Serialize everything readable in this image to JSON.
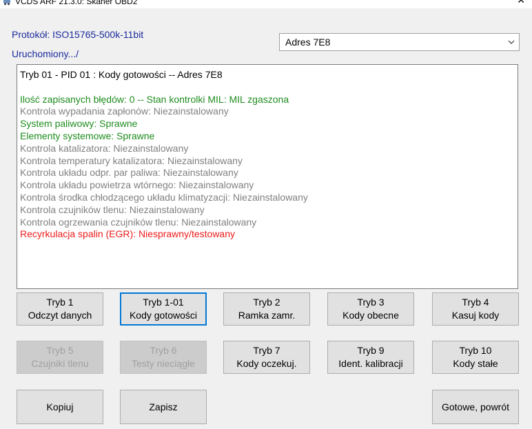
{
  "window": {
    "title": "VCDS ARF 21.3.0: Skaner OBD2",
    "close_glyph": "✕"
  },
  "header": {
    "protocol": "Protokół: ISO15765-500k-11bit",
    "status": "Uruchomiony.../"
  },
  "address_select": {
    "selected": "Adres 7E8"
  },
  "output": {
    "lines": [
      {
        "text": "Tryb 01 - PID 01 : Kody gotowości  --  Adres 7E8",
        "color": "#000000"
      },
      {
        "text": "",
        "color": "#000000"
      },
      {
        "text": "Ilość zapisanych błędów: 0  --  Stan kontrolki MIL: MIL zgaszona",
        "color": "#1e8c1e"
      },
      {
        "text": "Kontrola wypadania zapłonów: Niezainstalowany",
        "color": "#808080"
      },
      {
        "text": "System paliwowy:  Sprawne",
        "color": "#1e8c1e"
      },
      {
        "text": "Elementy systemowe:  Sprawne",
        "color": "#1e8c1e"
      },
      {
        "text": "Kontrola katalizatora: Niezainstalowany",
        "color": "#808080"
      },
      {
        "text": "Kontrola temperatury katalizatora: Niezainstalowany",
        "color": "#808080"
      },
      {
        "text": "Kontrola układu odpr. par paliwa: Niezainstalowany",
        "color": "#808080"
      },
      {
        "text": "Kontrola układu powietrza wtórnego: Niezainstalowany",
        "color": "#808080"
      },
      {
        "text": "Kontrola środka chłodzącego układu klimatyzacji: Niezainstalowany",
        "color": "#808080"
      },
      {
        "text": "Kontrola czujników tlenu: Niezainstalowany",
        "color": "#808080"
      },
      {
        "text": "Kontrola ogrzewania czujników tlenu: Niezainstalowany",
        "color": "#808080"
      },
      {
        "text": "Recyrkulacja spalin (EGR):  Niesprawny/testowany",
        "color": "#ee1c1c"
      }
    ]
  },
  "buttons": {
    "row1": [
      {
        "line1": "Tryb 1",
        "line2": "Odczyt danych"
      },
      {
        "line1": "Tryb 1-01",
        "line2": "Kody gotowości"
      },
      {
        "line1": "Tryb 2",
        "line2": "Ramka zamr."
      },
      {
        "line1": "Tryb 3",
        "line2": "Kody obecne"
      },
      {
        "line1": "Tryb 4",
        "line2": "Kasuj kody"
      }
    ],
    "row2": [
      {
        "line1": "Tryb 5",
        "line2": "Czujniki tlenu"
      },
      {
        "line1": "Tryb 6",
        "line2": "Testy nieciągłe"
      },
      {
        "line1": "Tryb 7",
        "line2": "Kody oczekuj."
      },
      {
        "line1": "Tryb 9",
        "line2": "Ident. kalibracji"
      },
      {
        "line1": "Tryb 10",
        "line2": "Kody stałe"
      }
    ],
    "copy": "Kopiuj",
    "save": "Zapisz",
    "done": "Gotowe, powrót"
  }
}
